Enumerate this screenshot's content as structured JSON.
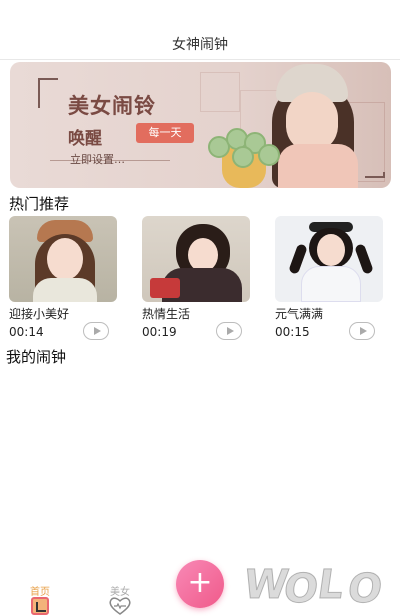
{
  "header": {
    "title": "女神闹钟"
  },
  "banner": {
    "title": "美女闹铃",
    "subtitle": "唤醒",
    "badge": "每一天",
    "link": "立即设置…"
  },
  "hot": {
    "title": "热门推荐",
    "items": [
      {
        "name": "迎接小美好",
        "time": "00:14"
      },
      {
        "name": "热情生活",
        "time": "00:19"
      },
      {
        "name": "元气满满",
        "time": "00:15"
      }
    ]
  },
  "my_alarms": {
    "title": "我的闹钟"
  },
  "tabbar": {
    "home_label": "首页",
    "girl_label": "美女",
    "add_icon": "plus-icon"
  },
  "watermark": {
    "text": "wolo"
  },
  "colors": {
    "accent_pink": "#f05a8a",
    "badge_red": "#e26d5e",
    "home_active": "#e8a14a"
  }
}
